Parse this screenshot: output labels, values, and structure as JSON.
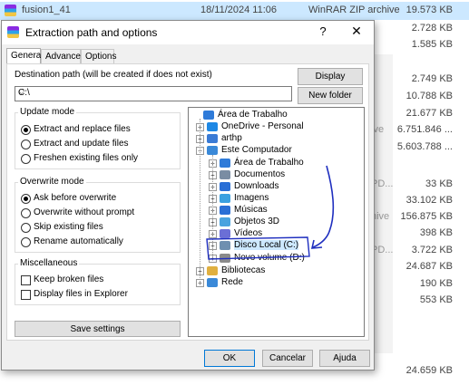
{
  "background": {
    "rows": [
      {
        "name": "fusion1_41",
        "date": "18/11/2024 11:06",
        "type": "WinRAR ZIP archive",
        "size": "19.573 KB",
        "selected": true
      },
      {
        "name": "",
        "date": "",
        "type": "",
        "size": "2.728 KB"
      },
      {
        "name": "",
        "date": "",
        "type": "",
        "size": "1.585 KB"
      },
      {
        "name": "",
        "date": "",
        "type": "",
        "size": "2.749 KB"
      },
      {
        "name": "",
        "date": "",
        "type": "",
        "size": "10.788 KB"
      },
      {
        "name": "",
        "date": "",
        "type": "",
        "size": "21.677 KB"
      },
      {
        "name": "",
        "date": "",
        "type": "ive",
        "size": "6.751.846 ..."
      },
      {
        "name": "",
        "date": "",
        "type": "",
        "size": "5.603.788 ..."
      },
      {
        "name": "",
        "date": "",
        "type": "PD...",
        "size": "33 KB"
      },
      {
        "name": "",
        "date": "",
        "type": "",
        "size": "33.102 KB"
      },
      {
        "name": "",
        "date": "",
        "type": "hive",
        "size": "156.875 KB"
      },
      {
        "name": "",
        "date": "",
        "type": "",
        "size": "398 KB"
      },
      {
        "name": "",
        "date": "",
        "type": "PD...",
        "size": "3.722 KB"
      },
      {
        "name": "",
        "date": "",
        "type": "",
        "size": "24.687 KB"
      },
      {
        "name": "",
        "date": "",
        "type": "",
        "size": "190 KB"
      },
      {
        "name": "",
        "date": "",
        "type": "",
        "size": "553 KB"
      },
      {
        "name": "",
        "date": "",
        "type": "",
        "size": "24.659 KB"
      }
    ]
  },
  "dialog": {
    "title": "Extraction path and options",
    "help_glyph": "?",
    "close_glyph": "✕",
    "tabs": [
      {
        "label": "General",
        "active": true
      },
      {
        "label": "Advanced",
        "active": false
      },
      {
        "label": "Options",
        "active": false
      }
    ],
    "destination_label": "Destination path (will be created if does not exist)",
    "destination_value": "C:\\",
    "display_button": "Display",
    "new_folder_button": "New folder",
    "update_mode": {
      "title": "Update mode",
      "options": [
        {
          "label": "Extract and replace files",
          "selected": true
        },
        {
          "label": "Extract and update files",
          "selected": false
        },
        {
          "label": "Freshen existing files only",
          "selected": false
        }
      ]
    },
    "overwrite_mode": {
      "title": "Overwrite mode",
      "options": [
        {
          "label": "Ask before overwrite",
          "selected": true
        },
        {
          "label": "Overwrite without prompt",
          "selected": false
        },
        {
          "label": "Skip existing files",
          "selected": false
        },
        {
          "label": "Rename automatically",
          "selected": false
        }
      ]
    },
    "miscellaneous": {
      "title": "Miscellaneous",
      "options": [
        {
          "label": "Keep broken files",
          "checked": false
        },
        {
          "label": "Display files in Explorer",
          "checked": false
        }
      ]
    },
    "save_settings_button": "Save settings",
    "tree": [
      {
        "label": "Área de Trabalho",
        "expander": "",
        "icon": "desktop-icon",
        "color": "#2f7bd9"
      },
      {
        "label": "OneDrive - Personal",
        "expander": "+",
        "icon": "cloud-icon",
        "color": "#1e88e5"
      },
      {
        "label": "arthp",
        "expander": "+",
        "icon": "user-icon",
        "color": "#3a7bd5"
      },
      {
        "label": "Este Computador",
        "expander": "−",
        "icon": "computer-icon",
        "color": "#3a89d8"
      },
      {
        "label": "Área de Trabalho",
        "expander": "+",
        "icon": "desktop-icon",
        "color": "#2f7bd9"
      },
      {
        "label": "Documentos",
        "expander": "+",
        "icon": "documents-icon",
        "color": "#7a8da3"
      },
      {
        "label": "Downloads",
        "expander": "+",
        "icon": "download-icon",
        "color": "#2a6fd6"
      },
      {
        "label": "Imagens",
        "expander": "+",
        "icon": "pictures-icon",
        "color": "#3aa0e0"
      },
      {
        "label": "Músicas",
        "expander": "+",
        "icon": "music-icon",
        "color": "#2a6fd6"
      },
      {
        "label": "Objetos 3D",
        "expander": "+",
        "icon": "cube-icon",
        "color": "#4aa3df"
      },
      {
        "label": "Vídeos",
        "expander": "+",
        "icon": "video-icon",
        "color": "#6b6fd6"
      },
      {
        "label": "Disco Local (C:)",
        "expander": "+",
        "icon": "drive-icon",
        "color": "#6f8fb0",
        "selected": true
      },
      {
        "label": "Novo volume (D:)",
        "expander": "+",
        "icon": "drive-icon",
        "color": "#8a8a8a"
      },
      {
        "label": "Bibliotecas",
        "expander": "+",
        "icon": "library-icon",
        "color": "#e0b040"
      },
      {
        "label": "Rede",
        "expander": "+",
        "icon": "network-icon",
        "color": "#3a89d8"
      }
    ],
    "ok_button": "OK",
    "cancel_button": "Cancelar",
    "help_button": "Ajuda",
    "annotation_color": "#1f2fbf"
  }
}
